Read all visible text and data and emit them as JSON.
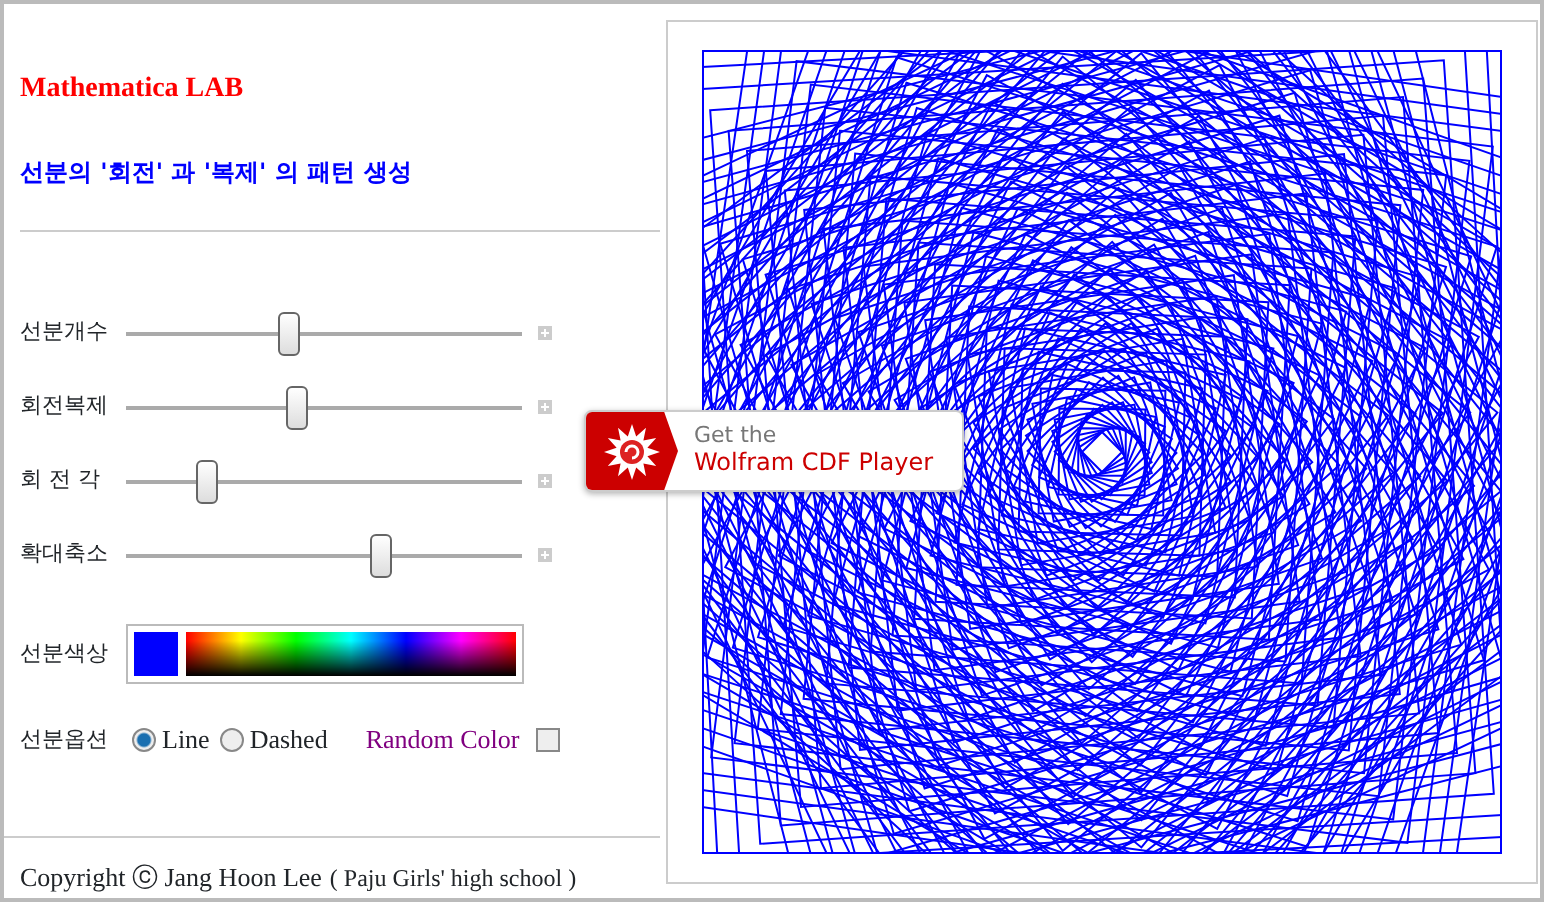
{
  "header": {
    "title": "Mathematica LAB",
    "subtitle": "선분의 '회전' 과 '복제' 의 패턴 생성"
  },
  "sliders": [
    {
      "label": "선분개수",
      "level": 0.41
    },
    {
      "label": "회전복제",
      "level": 0.43
    },
    {
      "label": "회 전 각",
      "level": 0.2
    },
    {
      "label": "확대축소",
      "level": 0.64
    }
  ],
  "color_picker": {
    "label": "선분색상",
    "color": "#0000ff"
  },
  "line_options": {
    "label": "선분옵션",
    "radios": [
      {
        "label": "Line",
        "selected": true
      },
      {
        "label": "Dashed",
        "selected": false
      }
    ],
    "random_color": {
      "label": "Random Color",
      "checked": false
    }
  },
  "footer": {
    "copyright": "Copyright ⓒ Jang Hoon Lee",
    "school": "( Paju Girls' high school )"
  },
  "cdf_badge": {
    "line_1": "Get the",
    "line_2": "Wolfram CDF Player"
  }
}
